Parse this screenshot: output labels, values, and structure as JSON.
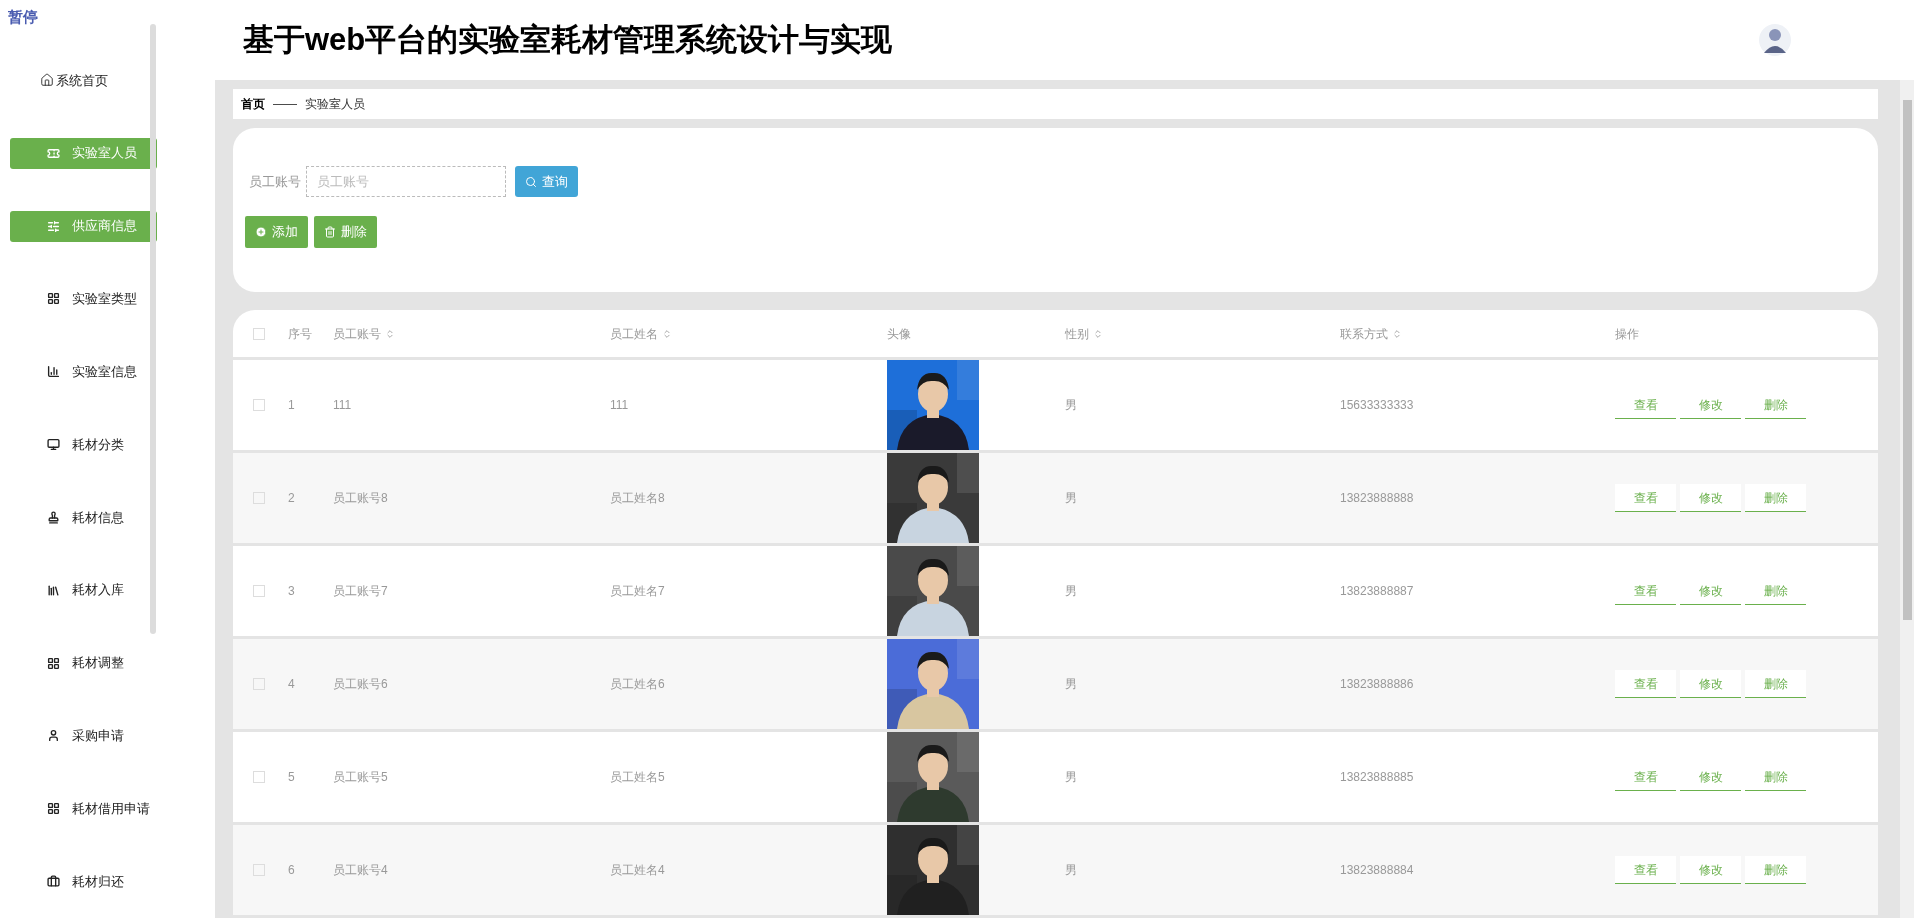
{
  "overlay_label": "暂停",
  "sidebar": {
    "items": [
      {
        "label": "系统首页",
        "selected": false
      },
      {
        "label": "实验室人员",
        "selected": true
      },
      {
        "label": "供应商信息",
        "selected": true
      },
      {
        "label": "实验室类型",
        "selected": false
      },
      {
        "label": "实验室信息",
        "selected": false
      },
      {
        "label": "耗材分类",
        "selected": false
      },
      {
        "label": "耗材信息",
        "selected": false
      },
      {
        "label": "耗材入库",
        "selected": false
      },
      {
        "label": "耗材调整",
        "selected": false
      },
      {
        "label": "采购申请",
        "selected": false
      },
      {
        "label": "耗材借用申请",
        "selected": false
      },
      {
        "label": "耗材归还",
        "selected": false
      }
    ]
  },
  "header": {
    "title": "基于web平台的实验室耗材管理系统设计与实现"
  },
  "breadcrumb": {
    "home": "首页",
    "separator": "——",
    "current": "实验室人员"
  },
  "search": {
    "label": "员工账号",
    "placeholder": "员工账号",
    "button": "查询"
  },
  "actions": {
    "add": "添加",
    "delete": "删除"
  },
  "table": {
    "select_all_checked": false,
    "columns": [
      {
        "label": "序号",
        "sortable": false
      },
      {
        "label": "员工账号",
        "sortable": true
      },
      {
        "label": "员工姓名",
        "sortable": true
      },
      {
        "label": "头像",
        "sortable": false
      },
      {
        "label": "性别",
        "sortable": true
      },
      {
        "label": "联系方式",
        "sortable": true
      },
      {
        "label": "操作",
        "sortable": false
      }
    ],
    "rows": [
      {
        "checked": false,
        "index": "1",
        "account": "111",
        "name": "111",
        "gender": "男",
        "phone": "15633333333",
        "row_actions": [
          "查看",
          "修改",
          "删除"
        ]
      },
      {
        "checked": false,
        "index": "2",
        "account": "员工账号8",
        "name": "员工姓名8",
        "gender": "男",
        "phone": "13823888888",
        "row_actions": [
          "查看",
          "修改",
          "删除"
        ]
      },
      {
        "checked": false,
        "index": "3",
        "account": "员工账号7",
        "name": "员工姓名7",
        "gender": "男",
        "phone": "13823888887",
        "row_actions": [
          "查看",
          "修改",
          "删除"
        ]
      },
      {
        "checked": false,
        "index": "4",
        "account": "员工账号6",
        "name": "员工姓名6",
        "gender": "男",
        "phone": "13823888886",
        "row_actions": [
          "查看",
          "修改",
          "删除"
        ]
      },
      {
        "checked": false,
        "index": "5",
        "account": "员工账号5",
        "name": "员工姓名5",
        "gender": "男",
        "phone": "13823888885",
        "row_actions": [
          "查看",
          "修改",
          "删除"
        ]
      },
      {
        "checked": false,
        "index": "6",
        "account": "员工账号4",
        "name": "员工姓名4",
        "gender": "男",
        "phone": "13823888884",
        "row_actions": [
          "查看",
          "修改",
          "删除"
        ]
      }
    ]
  }
}
